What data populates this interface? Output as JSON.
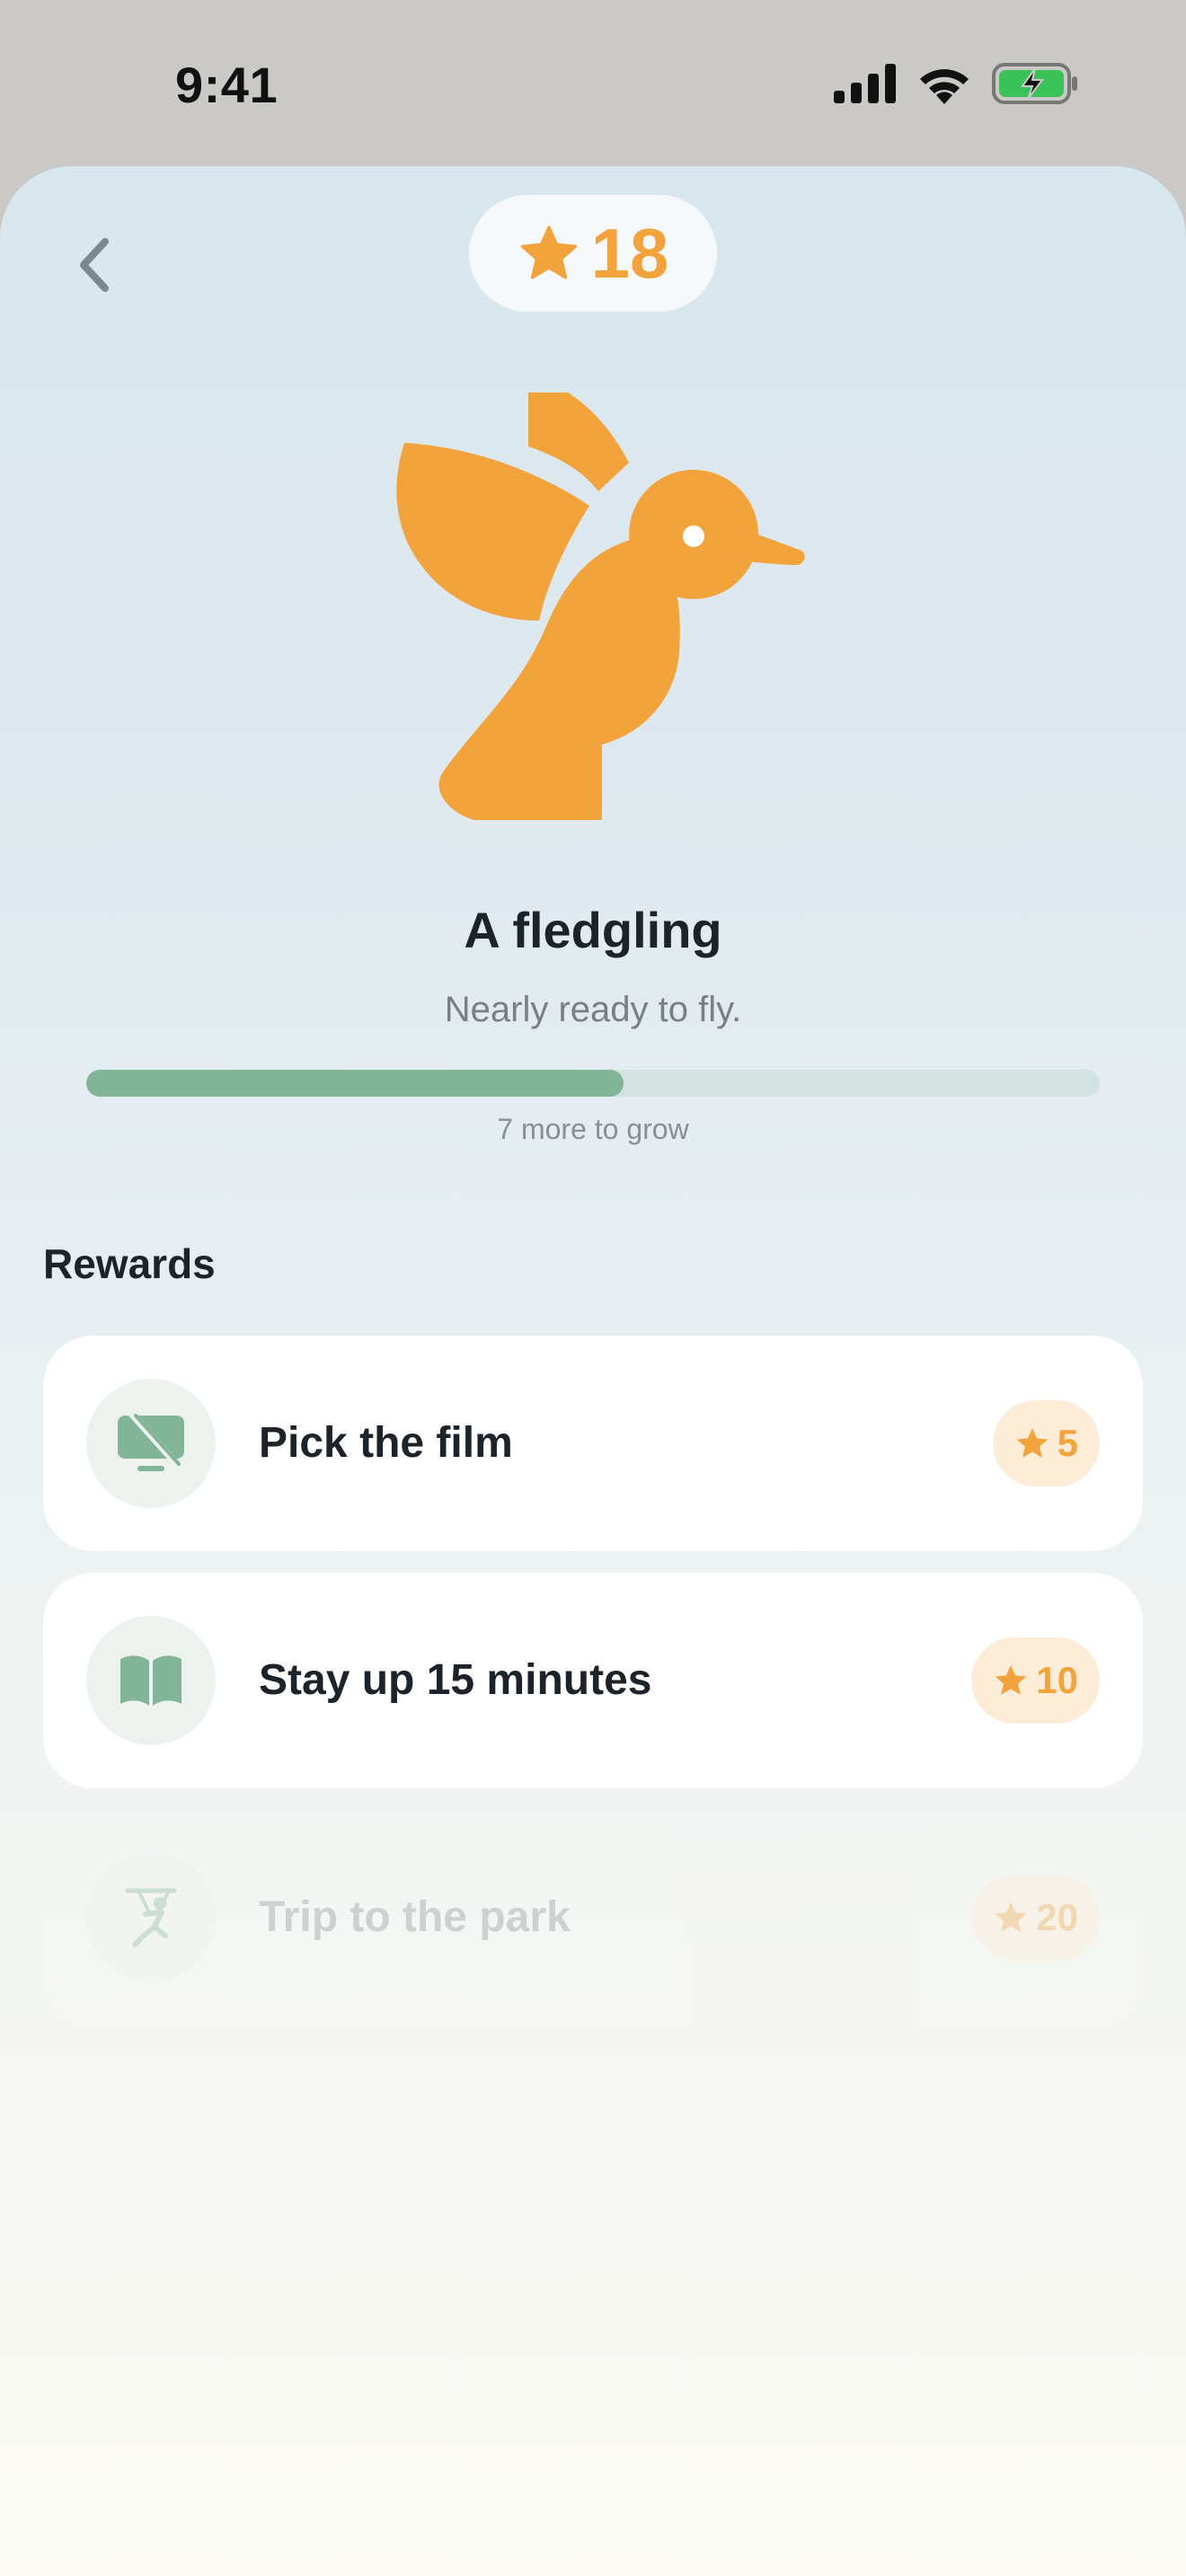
{
  "status": {
    "time": "9:41"
  },
  "header": {
    "star_count": "18"
  },
  "creature": {
    "title": "A fledgling",
    "subtitle": "Nearly ready to fly.",
    "progress": 0.53,
    "progress_note": "7 more to grow"
  },
  "rewards": {
    "section_title": "Rewards",
    "items": [
      {
        "label": "Pick the film",
        "cost": "5",
        "icon": "tv-off-icon"
      },
      {
        "label": "Stay up 15 minutes",
        "cost": "10",
        "icon": "book-icon"
      },
      {
        "label": "Trip to the park",
        "cost": "20",
        "icon": "swing-icon"
      }
    ]
  },
  "colors": {
    "accent": "#F2A33C",
    "progress": "#82B598",
    "icon_green": "#82B598"
  }
}
